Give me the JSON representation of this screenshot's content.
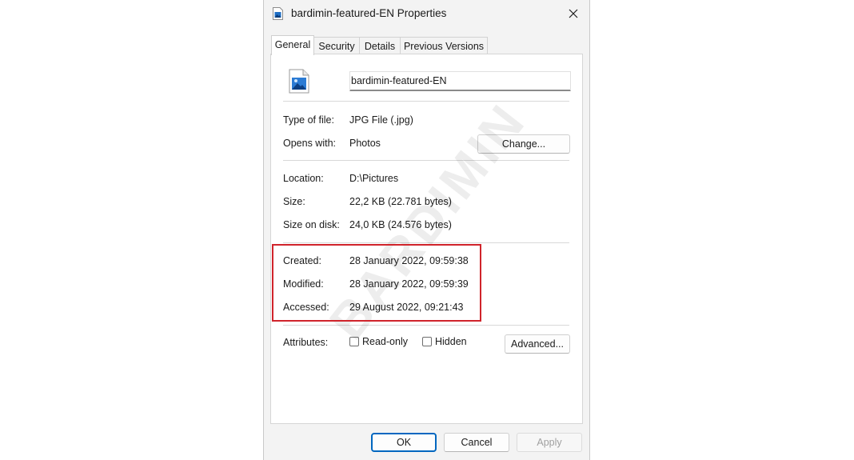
{
  "window": {
    "title": "bardimin-featured-EN Properties",
    "close_icon": "close-icon"
  },
  "tabs": [
    {
      "label": "General",
      "active": true
    },
    {
      "label": "Security",
      "active": false
    },
    {
      "label": "Details",
      "active": false
    },
    {
      "label": "Previous Versions",
      "active": false
    }
  ],
  "general": {
    "file_name": "bardimin-featured-EN",
    "file_icon": "image-file-icon",
    "type_label": "Type of file:",
    "type_value": "JPG File (.jpg)",
    "opens_label": "Opens with:",
    "opens_value": "Photos",
    "change_button": "Change...",
    "location_label": "Location:",
    "location_value": "D:\\Pictures",
    "size_label": "Size:",
    "size_value": "22,2 KB (22.781 bytes)",
    "size_disk_label": "Size on disk:",
    "size_disk_value": "24,0 KB (24.576 bytes)",
    "created_label": "Created:",
    "created_value": "28 January 2022, 09:59:38",
    "modified_label": "Modified:",
    "modified_value": "28 January 2022, 09:59:39",
    "accessed_label": "Accessed:",
    "accessed_value": "29 August 2022, 09:21:43",
    "attributes_label": "Attributes:",
    "readonly_label": "Read-only",
    "readonly_checked": false,
    "hidden_label": "Hidden",
    "hidden_checked": false,
    "advanced_button": "Advanced..."
  },
  "buttons": {
    "ok": "OK",
    "cancel": "Cancel",
    "apply": "Apply"
  },
  "overlay": {
    "highlight_color": "#d0242b",
    "watermark": "BARDIMIN"
  },
  "colors": {
    "dialog_bg": "#f3f3f3",
    "panel_bg": "#ffffff",
    "ok_border": "#0067c0",
    "disabled_text": "#a0a0a0"
  }
}
